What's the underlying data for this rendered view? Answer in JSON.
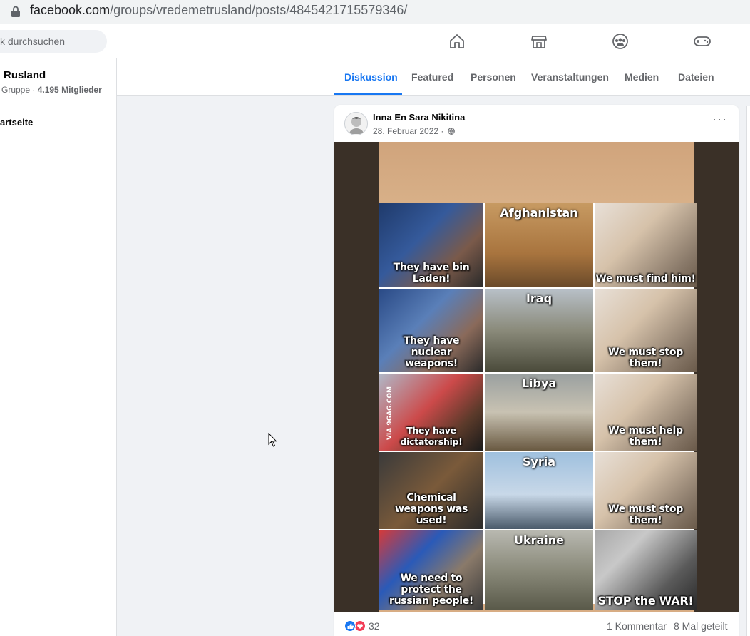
{
  "browser": {
    "url_host": "facebook.com",
    "url_path": "/groups/vredemetrusland/posts/4845421715579346/",
    "lock_icon": "lock-icon"
  },
  "topnav": {
    "search_placeholder": "k durchsuchen",
    "icons": [
      "home-icon",
      "marketplace-icon",
      "groups-icon",
      "gaming-icon"
    ]
  },
  "group": {
    "name": "Rusland",
    "meta_prefix": "Gruppe · ",
    "members": "4.195 Mitglieder",
    "home_link": "artseite"
  },
  "tabs": [
    {
      "label": "Diskussion",
      "active": true
    },
    {
      "label": "Featured"
    },
    {
      "label": "Personen"
    },
    {
      "label": "Veranstaltungen"
    },
    {
      "label": "Medien"
    },
    {
      "label": "Dateien"
    }
  ],
  "post": {
    "author": "Inna En Sara Nikitina",
    "date": "28. Februar 2022 · ",
    "more": "···",
    "reaction_count": "32",
    "comments": "1 Kommentar",
    "shares": "8 Mal geteilt",
    "meme": {
      "watermark": "VIA 9GAG.COM",
      "rows": [
        {
          "left": "They have bin Laden!",
          "country": "Afghanistan",
          "right": "We must find him!"
        },
        {
          "left": "They have nuclear weapons!",
          "country": "Iraq",
          "right": "We must stop them!"
        },
        {
          "left": "They have dictatorship!",
          "country": "Libya",
          "right": "We must help them!"
        },
        {
          "left": "Chemical weapons was used!",
          "country": "Syria",
          "right": "We must stop them!"
        },
        {
          "left": "We need to protect the russian people!",
          "country": "Ukraine",
          "right": "STOP the WAR!"
        }
      ]
    }
  },
  "colors": {
    "accent": "#1877f2",
    "secondary_text": "#65676b",
    "background": "#f0f2f5"
  }
}
